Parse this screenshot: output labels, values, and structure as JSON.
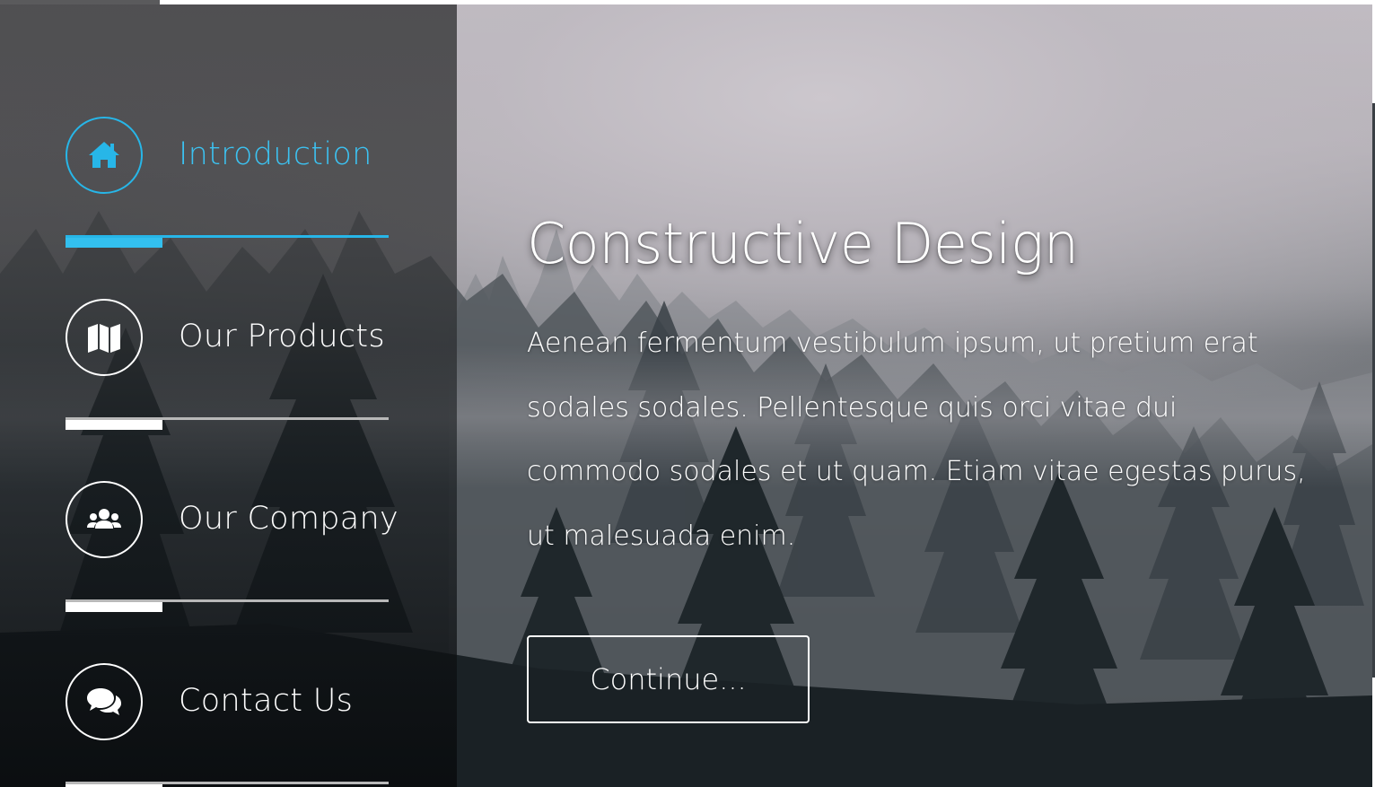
{
  "colors": {
    "accent": "#27b6e8",
    "accent_text": "#3cc2f1",
    "text": "#ffffff"
  },
  "sidebar": {
    "items": [
      {
        "label": "Introduction",
        "icon": "home-icon",
        "active": true,
        "progress": 0.3
      },
      {
        "label": "Our Products",
        "icon": "map-icon",
        "active": false,
        "progress": 0.3
      },
      {
        "label": "Our Company",
        "icon": "users-icon",
        "active": false,
        "progress": 0.3
      },
      {
        "label": "Contact Us",
        "icon": "comments-icon",
        "active": false,
        "progress": 0.3
      }
    ]
  },
  "main": {
    "title": "Constructive Design",
    "body": "Aenean fermentum vestibulum ipsum, ut pretium erat sodales sodales. Pellentesque quis orci vitae dui commodo sodales et ut quam. Etiam vitae egestas purus, ut malesuada enim.",
    "button_label": "Continue..."
  }
}
